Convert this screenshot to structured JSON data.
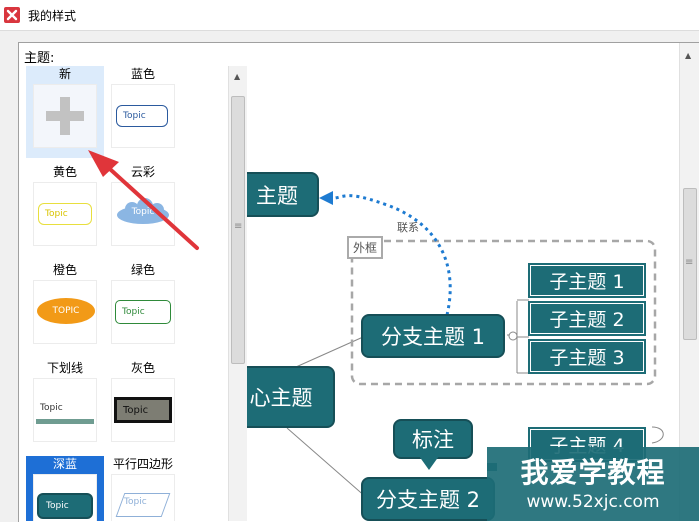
{
  "window": {
    "title": "我的样式"
  },
  "panel": {
    "label": "主题:"
  },
  "themes": [
    {
      "name": "新",
      "preview": "+"
    },
    {
      "name": "蓝色",
      "preview": "Topic"
    },
    {
      "name": "黄色",
      "preview": "Topic"
    },
    {
      "name": "云彩",
      "preview": "Topic"
    },
    {
      "name": "橙色",
      "preview": "TOPIC"
    },
    {
      "name": "绿色",
      "preview": "Topic"
    },
    {
      "name": "下划线",
      "preview": "Topic"
    },
    {
      "name": "灰色",
      "preview": "Topic"
    },
    {
      "name": "深蓝",
      "preview": "Topic"
    },
    {
      "name": "平行四边形",
      "preview": "Topic"
    }
  ],
  "map": {
    "main_topic": "主题",
    "center_topic": "心主题",
    "relation_label": "联系",
    "frame_label": "外框",
    "branch1": "分支主题 1",
    "branch2": "分支主题 2",
    "subtopics": [
      "子主题 1",
      "子主题 2",
      "子主题 3"
    ],
    "subtopic4": "子主题 4",
    "callout": "标注"
  },
  "watermark": {
    "main": "我爱学教程",
    "url": "www.52xjc.com"
  },
  "colors": {
    "node": "#1d6c76",
    "selection": "#1e6fd6",
    "arrow": "#e0353a",
    "relation": "#1e7bd1"
  }
}
